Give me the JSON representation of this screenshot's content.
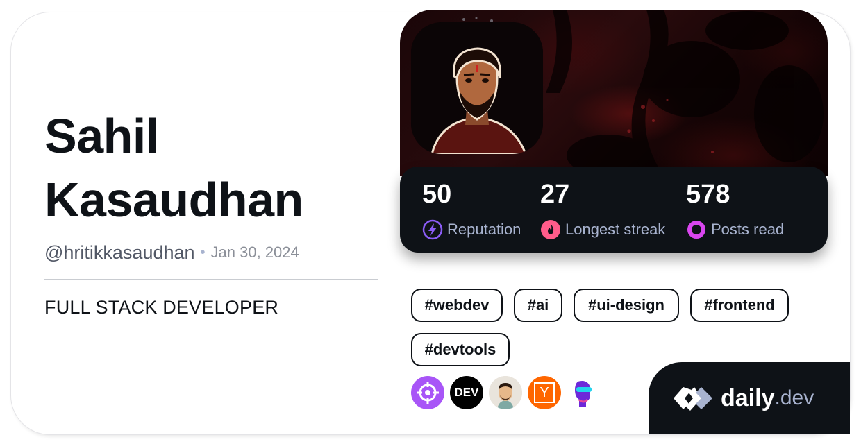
{
  "profile": {
    "first_name": "Sahil",
    "last_name": "Kasaudhan",
    "handle": "@hritikkasaudhan",
    "separator": "•",
    "joined": "Jan 30, 2024",
    "bio": "FULL STACK DEVELOPER"
  },
  "stats": [
    {
      "value": "50",
      "label": "Reputation",
      "icon": "reputation-bolt-icon",
      "color": "#8b5cf6"
    },
    {
      "value": "27",
      "label": "Longest streak",
      "icon": "streak-flame-icon",
      "color": "#ff5c8a"
    },
    {
      "value": "578",
      "label": "Posts read",
      "icon": "posts-read-ring-icon",
      "color": "#d946ef"
    }
  ],
  "tags": [
    "#webdev",
    "#ai",
    "#ui-design",
    "#frontend",
    "#devtools"
  ],
  "sources": [
    {
      "icon": "crosshair-source-icon",
      "color": "#a855f7"
    },
    {
      "icon": "dev-to-source-icon",
      "text": "DEV",
      "color": "#000000"
    },
    {
      "icon": "memoji-source-icon",
      "color": "#e6b88a"
    },
    {
      "icon": "hacker-news-source-icon",
      "text": "Y",
      "color": "#ff6600"
    },
    {
      "icon": "robot-head-source-icon",
      "color": "#6d28d9"
    }
  ],
  "brand": {
    "name": "daily",
    "suffix": ".dev"
  },
  "colors": {
    "background": "#ffffff",
    "dark": "#0e1217",
    "muted": "#a8b3cf"
  }
}
